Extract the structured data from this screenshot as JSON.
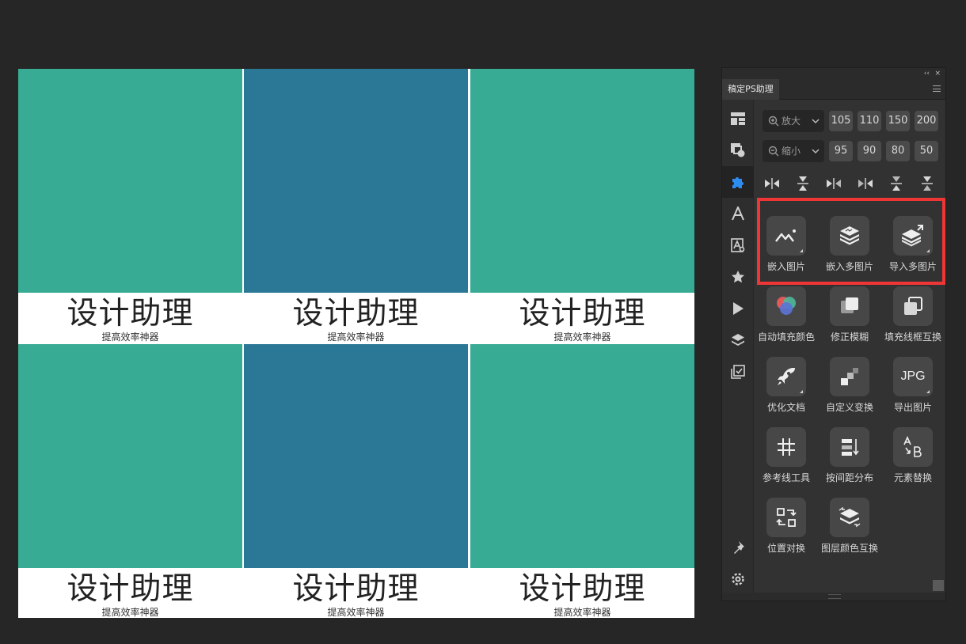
{
  "canvas": {
    "tiles": [
      {
        "color": "#37ab93",
        "title": "设计助理",
        "subtitle": "提高效率神器"
      },
      {
        "color": "#2a7896",
        "title": "设计助理",
        "subtitle": "提高效率神器"
      },
      {
        "color": "#37ab93",
        "title": "设计助理",
        "subtitle": "提高效率神器"
      },
      {
        "color": "#37ab93",
        "title": "设计助理",
        "subtitle": "提高效率神器"
      },
      {
        "color": "#2a7896",
        "title": "设计助理",
        "subtitle": "提高效率神器"
      },
      {
        "color": "#37ab93",
        "title": "设计助理",
        "subtitle": "提高效率神器"
      }
    ]
  },
  "panel": {
    "tab_label": "稿定PS助理",
    "collapse_glyph": "‹‹",
    "close_glyph": "×",
    "sidebar": [
      {
        "icon": "layout-icon"
      },
      {
        "icon": "shapes-icon"
      },
      {
        "icon": "puzzle-icon",
        "active": true
      },
      {
        "icon": "text-icon"
      },
      {
        "icon": "text-search-icon"
      },
      {
        "icon": "star-icon"
      },
      {
        "icon": "play-icon"
      },
      {
        "icon": "layers-icon"
      },
      {
        "icon": "checklist-icon"
      }
    ],
    "zoom_in": {
      "label": "放大",
      "presets": [
        "105",
        "110",
        "150",
        "200"
      ]
    },
    "zoom_out": {
      "label": "缩小",
      "presets": [
        "95",
        "90",
        "80",
        "50"
      ]
    },
    "align_icons": [
      "align-left-icon",
      "align-top-icon",
      "align-right-icon",
      "align-hcenter-icon",
      "align-vcenter-icon",
      "align-bottom-icon"
    ],
    "tools": [
      {
        "label": "嵌入图片",
        "icon": "embed-image-icon"
      },
      {
        "label": "嵌入多图片",
        "icon": "embed-multi-image-icon"
      },
      {
        "label": "导入多图片",
        "icon": "import-multi-image-icon"
      },
      {
        "label": "自动填充颜色",
        "icon": "auto-fill-color-icon"
      },
      {
        "label": "修正模糊",
        "icon": "fix-blur-icon"
      },
      {
        "label": "填充线框互换",
        "icon": "fill-stroke-swap-icon"
      },
      {
        "label": "优化文档",
        "icon": "rocket-icon"
      },
      {
        "label": "自定义变换",
        "icon": "custom-transform-icon"
      },
      {
        "label": "导出图片",
        "icon": "export-jpg-icon",
        "glyph": "JPG"
      },
      {
        "label": "参考线工具",
        "icon": "guides-icon"
      },
      {
        "label": "按间距分布",
        "icon": "distribute-icon"
      },
      {
        "label": "元素替换",
        "icon": "element-replace-icon"
      },
      {
        "label": "位置对换",
        "icon": "position-swap-icon"
      },
      {
        "label": "图层颜色互换",
        "icon": "layer-color-swap-icon"
      }
    ],
    "highlight_color": "#ef3636"
  }
}
